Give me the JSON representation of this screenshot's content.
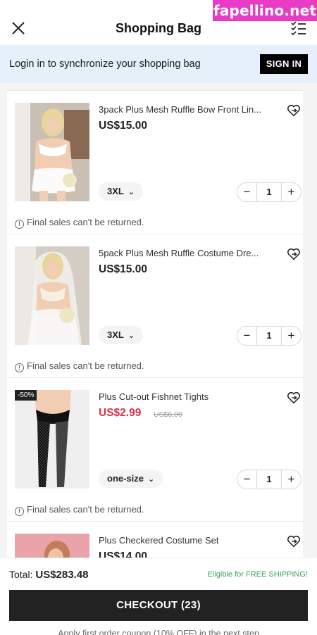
{
  "watermark": "fapellino.net",
  "header": {
    "title": "Shopping Bag"
  },
  "login_bar": {
    "text": "Login in to synchronize your shopping bag",
    "button": "SIGN IN"
  },
  "items": [
    {
      "name": "3pack Plus Mesh Ruffle Bow Front Lin...",
      "price": "US$15.00",
      "old_price": "",
      "badge": "",
      "size": "3XL",
      "quantity": "1",
      "note": "Final sales can't be returned.",
      "image": "white lingerie set photo"
    },
    {
      "name": "5pack Plus Mesh Ruffle Costume Dre...",
      "price": "US$15.00",
      "old_price": "",
      "badge": "",
      "size": "3XL",
      "quantity": "1",
      "note": "Final sales can't be returned.",
      "image": "white bridal costume photo"
    },
    {
      "name": "Plus Cut-out Fishnet Tights",
      "price": "US$2.99",
      "old_price": "US$6.00",
      "badge": "-50%",
      "size": "one-size",
      "quantity": "1",
      "note": "Final sales can't be returned.",
      "image": "black fishnet tights photo"
    },
    {
      "name": "Plus Checkered Costume Set",
      "price": "US$14.00",
      "old_price": "",
      "badge": "",
      "size": "",
      "quantity": "",
      "note": "",
      "image": "pink checkered costume photo"
    }
  ],
  "footer": {
    "total_label": "Total:",
    "total_value": "US$283.48",
    "shipping": "Eligible for FREE SHIPPING!",
    "checkout": "CHECKOUT (23)",
    "coupon": "Apply first order coupon (10% OFF) in the next step"
  },
  "colors": {
    "accent_sale": "#d9304a",
    "shipping_green": "#3aa35b",
    "login_bg": "#e6f0fb",
    "watermark_bg": "#e83cc6"
  }
}
